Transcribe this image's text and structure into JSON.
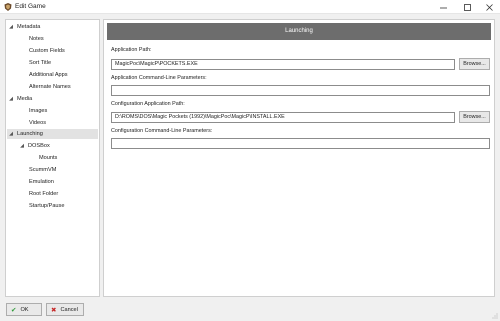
{
  "window": {
    "title": "Edit Game",
    "icons": {
      "app": "launchbox-app-icon",
      "minimize": "minimize-icon",
      "maximize": "maximize-icon",
      "close": "close-icon"
    }
  },
  "sidebar": {
    "items": [
      {
        "label": "Metadata",
        "expanded": true
      },
      {
        "label": "Notes"
      },
      {
        "label": "Custom Fields"
      },
      {
        "label": "Sort Title"
      },
      {
        "label": "Additional Apps"
      },
      {
        "label": "Alternate Names"
      },
      {
        "label": "Media",
        "expanded": true
      },
      {
        "label": "Images"
      },
      {
        "label": "Videos"
      },
      {
        "label": "Launching",
        "selected": true,
        "expanded": true
      },
      {
        "label": "DOSBox",
        "expanded": true
      },
      {
        "label": "Mounts"
      },
      {
        "label": "ScummVM"
      },
      {
        "label": "Emulation"
      },
      {
        "label": "Root Folder"
      },
      {
        "label": "Startup/Pause"
      }
    ]
  },
  "main": {
    "header": "Launching",
    "app_path_label": "Application Path:",
    "app_path_value": "MagicPoc\\MagicP\\POCKETS.EXE",
    "app_cmd_label": "Application Command-Line Parameters:",
    "app_cmd_value": "",
    "config_path_label": "Configuration Application Path:",
    "config_path_value": "D:\\ROMS\\DOS\\Magic Pockets (1992)\\MagicPoc\\MagicP\\INSTALL.EXE",
    "config_cmd_label": "Configuration Command-Line Parameters:",
    "config_cmd_value": "",
    "browse_label": "Browse..."
  },
  "footer": {
    "ok_label": "OK",
    "cancel_label": "Cancel"
  },
  "colors": {
    "header_bg": "#6d6d6d",
    "ok_icon": "#2e9b38",
    "cancel_icon": "#c62828"
  }
}
